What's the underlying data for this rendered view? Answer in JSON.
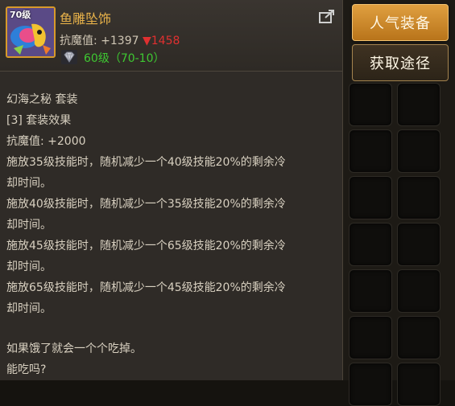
{
  "item": {
    "level_tag": "70级",
    "name": "鱼雕坠饰",
    "stat_label": "抗魔值: +1397",
    "stat_change": "▼1458",
    "level_req": "60级（70-10）"
  },
  "buttons": {
    "popular_gear": "人气装备",
    "obtain_method": "获取途径"
  },
  "description": {
    "set_name": "幻海之秘  套装",
    "set_effect_title": "[3] 套装效果",
    "set_stat": "抗魔值:  +2000",
    "effects": [
      "施放35级技能时，随机减少一个40级技能20%的剩余冷",
      "却时间。",
      "施放40级技能时，随机减少一个35级技能20%的剩余冷",
      "却时间。",
      "施放45级技能时，随机减少一个65级技能20%的剩余冷",
      "却时间。",
      "施放65级技能时，随机减少一个45级技能20%的剩余冷",
      "却时间。"
    ],
    "flavor": [
      "如果饿了就会一个个吃掉。",
      "能吃吗?"
    ]
  },
  "colors": {
    "name": "#e8b24a",
    "level_req": "#3ec832",
    "stat_down": "#e03030",
    "primary_button": "#c98a2e"
  },
  "icons": [
    "item-portrait-icon",
    "gem-icon",
    "share-icon"
  ]
}
